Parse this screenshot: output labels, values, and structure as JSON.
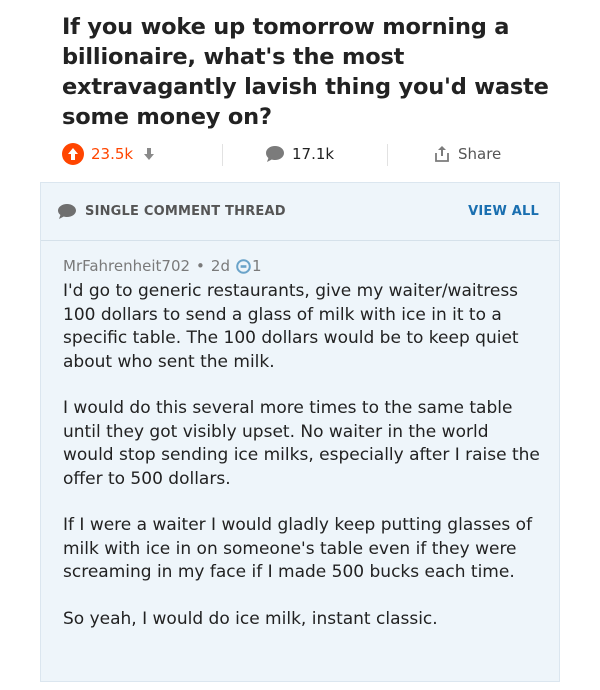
{
  "post": {
    "title": "If you woke up tomorrow morning a billionaire, what's the most extravagantly lavish thing you'd waste some money on?"
  },
  "actions": {
    "score": "23.5k",
    "comments": "17.1k",
    "share_label": "Share"
  },
  "thread": {
    "header_label": "SINGLE COMMENT THREAD",
    "view_all_label": "VIEW ALL"
  },
  "comment": {
    "author": "MrFahrenheit702",
    "separator": "•",
    "age": "2d",
    "award_count": "1",
    "paragraphs": [
      "I'd go to generic restaurants, give my waiter/waitress 100 dollars to send a glass of milk with ice in it to a specific table. The 100 dollars would be to keep quiet about who sent the milk.",
      "I would do this several more times to the same table until they got visibly upset. No waiter in the world would stop sending ice milks, especially after I raise the offer to 500 dollars.",
      "If I were a waiter I would gladly keep putting glasses of milk with ice in on someone's table even if they were screaming in my face if I made 500 bucks each time.",
      "So yeah, I would do ice milk, instant classic."
    ]
  },
  "colors": {
    "upvote": "#ff4500",
    "link": "#1a6fb0",
    "thread_bg": "#eef5fa"
  }
}
